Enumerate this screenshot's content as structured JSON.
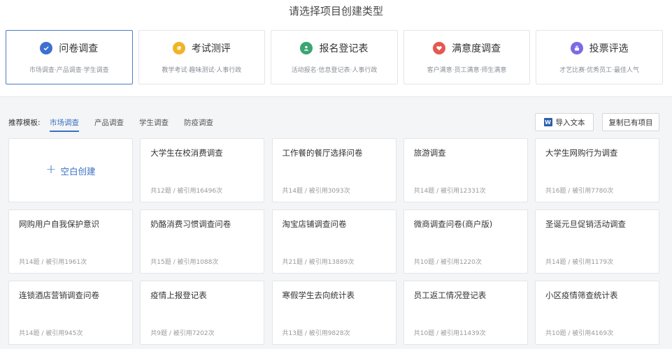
{
  "page_title": "请选择项目创建类型",
  "types": [
    {
      "name": "问卷调查",
      "desc": "市场调查·产品调查·学生调查",
      "icon": "check-circle-icon",
      "color": "#3f6fd1"
    },
    {
      "name": "考试测评",
      "desc": "教学考试·趣味测试·人事行政",
      "icon": "exam-icon",
      "color": "#f0b429"
    },
    {
      "name": "报名登记表",
      "desc": "活动报名·信息登记表·人事行政",
      "icon": "user-icon",
      "color": "#3aa572"
    },
    {
      "name": "满意度调查",
      "desc": "客户满意·员工满意·师生满意",
      "icon": "heart-icon",
      "color": "#e5584f"
    },
    {
      "name": "投票评选",
      "desc": "才艺比赛·优秀员工·最佳人气",
      "icon": "vote-icon",
      "color": "#7a6be3"
    }
  ],
  "toolbar": {
    "rec_label": "推荐模板:",
    "tabs": [
      "市场调查",
      "产品调查",
      "学生调查",
      "防疫调查"
    ],
    "import_label": "导入文本",
    "import_icon_letter": "W",
    "copy_label": "复制已有项目"
  },
  "blank": {
    "label": "空白创建",
    "icon": "plus-icon"
  },
  "templates": [
    {
      "title": "大学生在校消费调查",
      "meta": "共12题 / 被引用16496次"
    },
    {
      "title": "工作餐的餐厅选择问卷",
      "meta": "共14题 / 被引用3093次"
    },
    {
      "title": "旅游调查",
      "meta": "共14题 / 被引用12331次"
    },
    {
      "title": "大学生网购行为调查",
      "meta": "共16题 / 被引用7780次"
    },
    {
      "title": "网购用户自我保护意识",
      "meta": "共14题 / 被引用1961次"
    },
    {
      "title": "奶酪消费习惯调查问卷",
      "meta": "共15题 / 被引用1088次"
    },
    {
      "title": "淘宝店铺调查问卷",
      "meta": "共21题 / 被引用13889次"
    },
    {
      "title": "微商调查问卷(商户版)",
      "meta": "共10题 / 被引用1220次"
    },
    {
      "title": "圣诞元旦促销活动调查",
      "meta": "共14题 / 被引用1179次"
    },
    {
      "title": "连锁酒店营销调查问卷",
      "meta": "共14题 / 被引用945次"
    },
    {
      "title": "疫情上报登记表",
      "meta": "共9题 / 被引用7202次"
    },
    {
      "title": "寒假学生去向统计表",
      "meta": "共13题 / 被引用9828次"
    },
    {
      "title": "员工返工情况登记表",
      "meta": "共10题 / 被引用11439次"
    },
    {
      "title": "小区疫情筛查统计表",
      "meta": "共10题 / 被引用4169次"
    }
  ]
}
